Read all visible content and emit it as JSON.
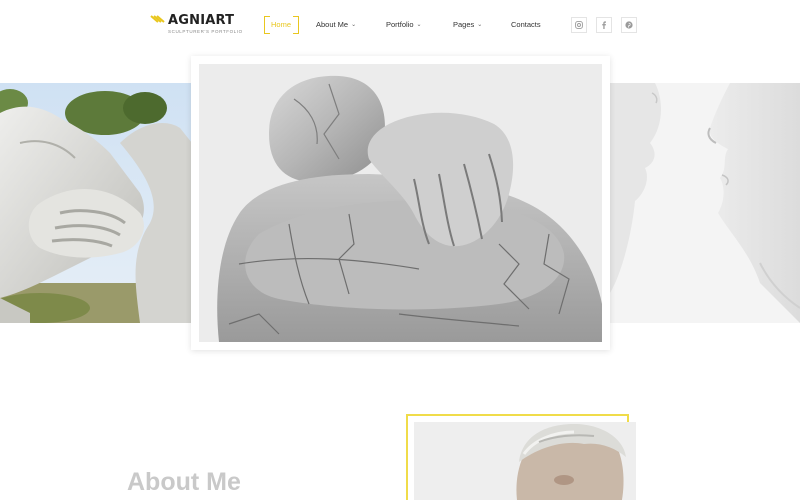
{
  "brand": {
    "name": "AGNIART",
    "tagline": "SCULPTURER'S PORTFOLIO",
    "accent_color": "#e9c71f"
  },
  "nav": {
    "items": [
      {
        "label": "Home",
        "active": true,
        "has_dropdown": false
      },
      {
        "label": "About Me",
        "active": false,
        "has_dropdown": true
      },
      {
        "label": "Portfolio",
        "active": false,
        "has_dropdown": true
      },
      {
        "label": "Pages",
        "active": false,
        "has_dropdown": true
      },
      {
        "label": "Contacts",
        "active": false,
        "has_dropdown": false
      }
    ],
    "chevron": "⌄"
  },
  "social": [
    "instagram-icon",
    "facebook-icon",
    "pinterest-icon"
  ],
  "hero": {
    "left_image": "stone-handshake-sculpture",
    "center_image": "marble-figure-arms-crossed-sculpture",
    "right_image": "white-faces-kiss-sculpture"
  },
  "about": {
    "title": "About Me",
    "photo": "portrait-gray-haired-man",
    "frame_color": "#f0dc4a"
  }
}
